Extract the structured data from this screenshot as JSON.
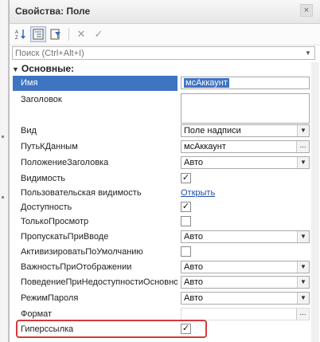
{
  "panel": {
    "title": "Свойства: Поле",
    "close_glyph": "×"
  },
  "toolbar": {
    "sort_icon": "sort-az-icon",
    "categories_icon": "categories-icon",
    "filter_icon": "filter-icon",
    "cancel_glyph": "✕",
    "ok_glyph": "✓"
  },
  "search": {
    "placeholder": "Поиск (Ctrl+Alt+I)"
  },
  "section": {
    "label": "Основные:",
    "arrow": "▼"
  },
  "properties": {
    "name": {
      "label": "Имя",
      "value": "мсАккаунт"
    },
    "title": {
      "label": "Заголовок",
      "value": ""
    },
    "view": {
      "label": "Вид",
      "value": "Поле надписи"
    },
    "data_path": {
      "label": "ПутьКДанным",
      "value": "мсАккаунт"
    },
    "title_position": {
      "label": "ПоложениеЗаголовка",
      "value": "Авто"
    },
    "visible": {
      "label": "Видимость",
      "checked": true
    },
    "user_visibility": {
      "label": "Пользовательская видимость",
      "link": "Открыть"
    },
    "enabled": {
      "label": "Доступность",
      "checked": true
    },
    "read_only": {
      "label": "ТолькоПросмотр",
      "checked": false
    },
    "skip_on_input": {
      "label": "ПропускатьПриВводе",
      "value": "Авто"
    },
    "activate_default": {
      "label": "АктивизироватьПоУмолчанию",
      "checked": false
    },
    "display_importance": {
      "label": "ВажностьПриОтображении",
      "value": "Авто"
    },
    "unavailable_behavior": {
      "label": "ПоведениеПриНедоступностиОсновно",
      "value": "Авто"
    },
    "password_mode": {
      "label": "РежимПароля",
      "value": "Авто"
    },
    "format": {
      "label": "Формат",
      "value": ""
    },
    "hyperlink": {
      "label": "Гиперссылка",
      "checked": true
    }
  },
  "glyphs": {
    "check": "✓",
    "dropdown": "▼",
    "ellipsis": "..."
  },
  "colors": {
    "selection": "#3f74c3",
    "highlight_border": "#d63a3a",
    "link": "#2250a6"
  }
}
